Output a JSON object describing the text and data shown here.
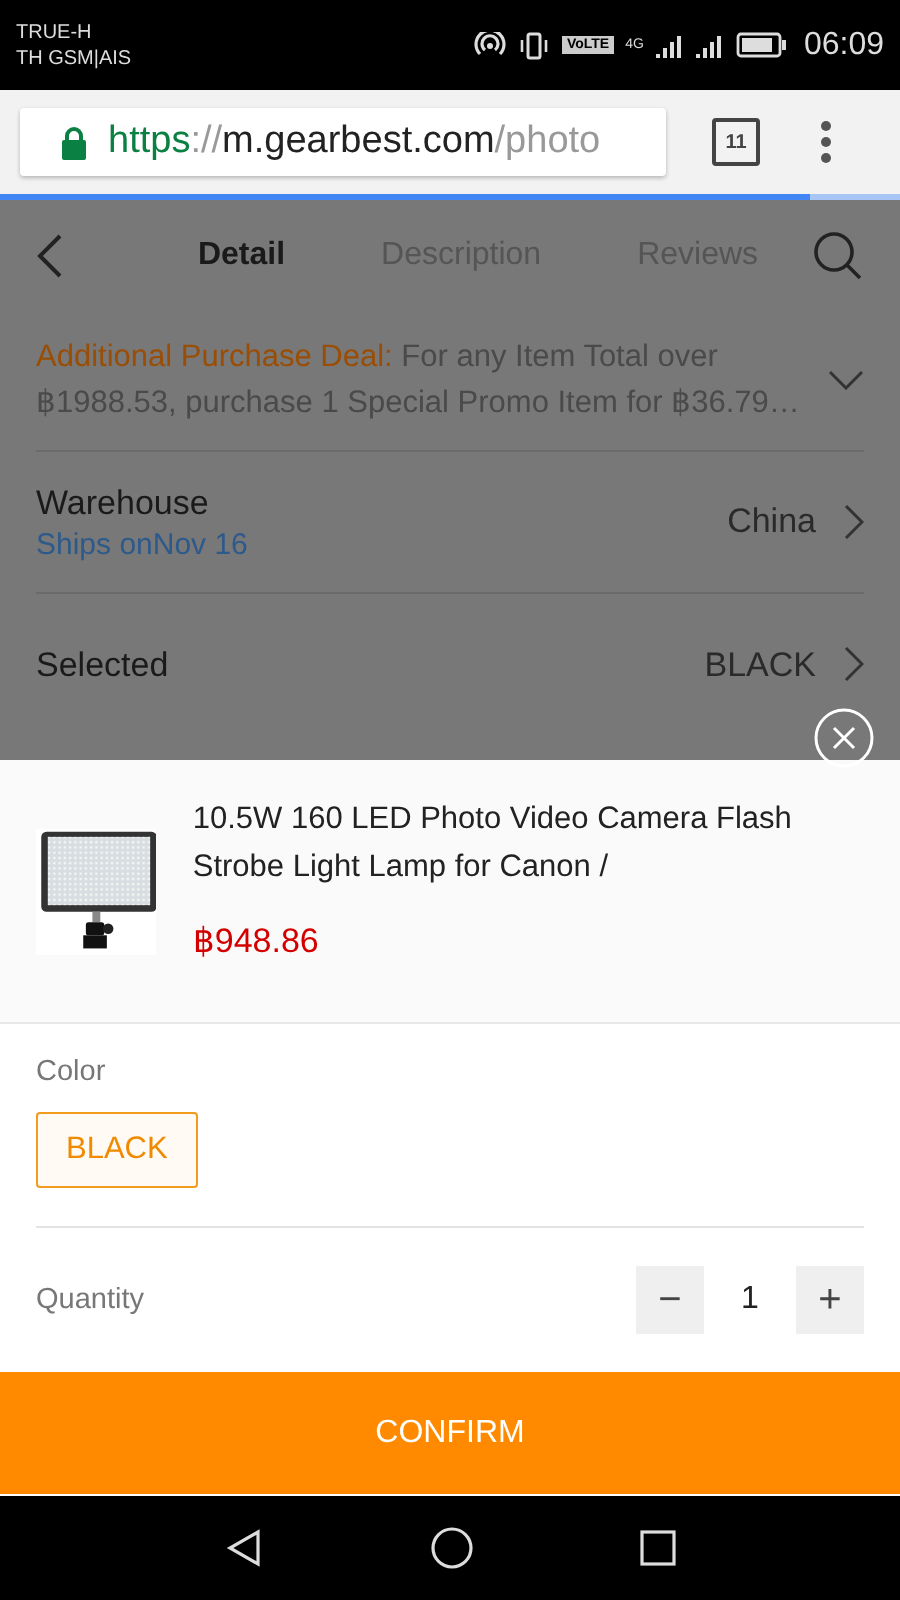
{
  "status_bar": {
    "carrier_1": "TRUE-H",
    "carrier_2": "TH GSM|AIS",
    "time": "06:09",
    "network_badge": "VoLTE",
    "network_type": "4G"
  },
  "browser": {
    "url_scheme": "https",
    "url_separator": "://",
    "url_host": "m.gearbest.com",
    "url_path": "/photo",
    "tab_count": "11",
    "load_progress": {
      "level": 0.9
    }
  },
  "tabs": [
    {
      "label": "Detail",
      "selected": true
    },
    {
      "label": "Description",
      "selected": false
    },
    {
      "label": "Reviews",
      "selected": false
    }
  ],
  "deal": {
    "label": "Additional Purchase Deal:",
    "text": "For any Item Total over ฿1988.53, purchase 1 Special Promo Item for ฿36.79…"
  },
  "warehouse": {
    "label": "Warehouse",
    "ships": "Ships onNov 16",
    "value": "China"
  },
  "selected_row": {
    "label": "Selected",
    "value": "BLACK"
  },
  "sheet": {
    "product": {
      "kind": "picture",
      "title": "10.5W 160 LED Photo Video Camera Flash Strobe Light Lamp for Canon /",
      "price": "฿948.86"
    },
    "color_label": "Color",
    "colors": [
      {
        "label": "BLACK",
        "selected": true
      }
    ],
    "quantity_label": "Quantity",
    "quantity": "1",
    "minus": "−",
    "plus": "+",
    "confirm": "CONFIRM"
  }
}
